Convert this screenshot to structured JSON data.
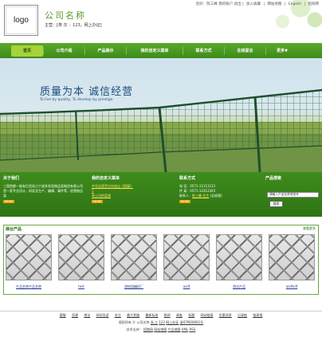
{
  "header": {
    "logo": "logo",
    "company_name": "公司名称",
    "slogan": "主营：[类 次 ：123，网上办证]",
    "top_links": [
      "您好：陈三峰 我的账户 退出 |",
      "加入收藏",
      "|",
      "网站地图",
      "|",
      "English",
      "|",
      "招商网"
    ]
  },
  "nav": {
    "items": [
      "首页",
      "公司介绍",
      "产品展示",
      "我的自定义菜单",
      "联系方式",
      "在线留言",
      "更多▼"
    ]
  },
  "banner": {
    "title": "质量为本  诚信经营",
    "subtitle": "To live by quality, To develop by prestige"
  },
  "about": {
    "title": "关于我们",
    "text": "三国首都一般有打造浙江宁波多发现物品类制造有限公司是一家专业设计，研发及生产、编辑、事件等，经营物品类",
    "more": "MORE"
  },
  "custom_menu": {
    "title": "我的自定义菜单",
    "link1": "中华全国烹饪协会出《国宴》",
    "link1b": "1",
    "link2": "来公司的菜谱",
    "more": "MORE"
  },
  "contact": {
    "title": "联系方式",
    "phone": "电 话：0571-11111111",
    "fax": "传 真：0571-12312345",
    "person_label": "联系人：",
    "person_name": "陈三峰 先生",
    "person_suffix": " (总经理)",
    "more": "MORE"
  },
  "product_search": {
    "title": "产品搜索",
    "placeholder": "请输入产品名称或型号",
    "button": "搜索"
  },
  "products": {
    "title": "展台产品",
    "more": "查看更多",
    "items": [
      "产品名称产品名称",
      "test",
      "测给组编好厂",
      "asdf",
      "测试产品",
      "asdfsdf"
    ]
  },
  "footer": {
    "links": [
      "客服",
      "资源",
      "地址",
      "网站导读",
      "关注",
      "最大到路",
      "最新标准",
      "联网",
      "调查",
      "标题",
      "网站链接",
      "优惠消息",
      "记录链",
      "链表报"
    ],
    "copyright_prefix": "版权所有 © 公司名称  ",
    "copyright_mid": "浙 江",
    "copyright_mid2": "123",
    "copyright_mid3": "网上办证",
    "copyright_icp": "浙ICP000001号",
    "support": "技术支持：",
    "support_links": [
      "招商网",
      "网站地图",
      "产品地图",
      "XML",
      "RSS"
    ]
  }
}
